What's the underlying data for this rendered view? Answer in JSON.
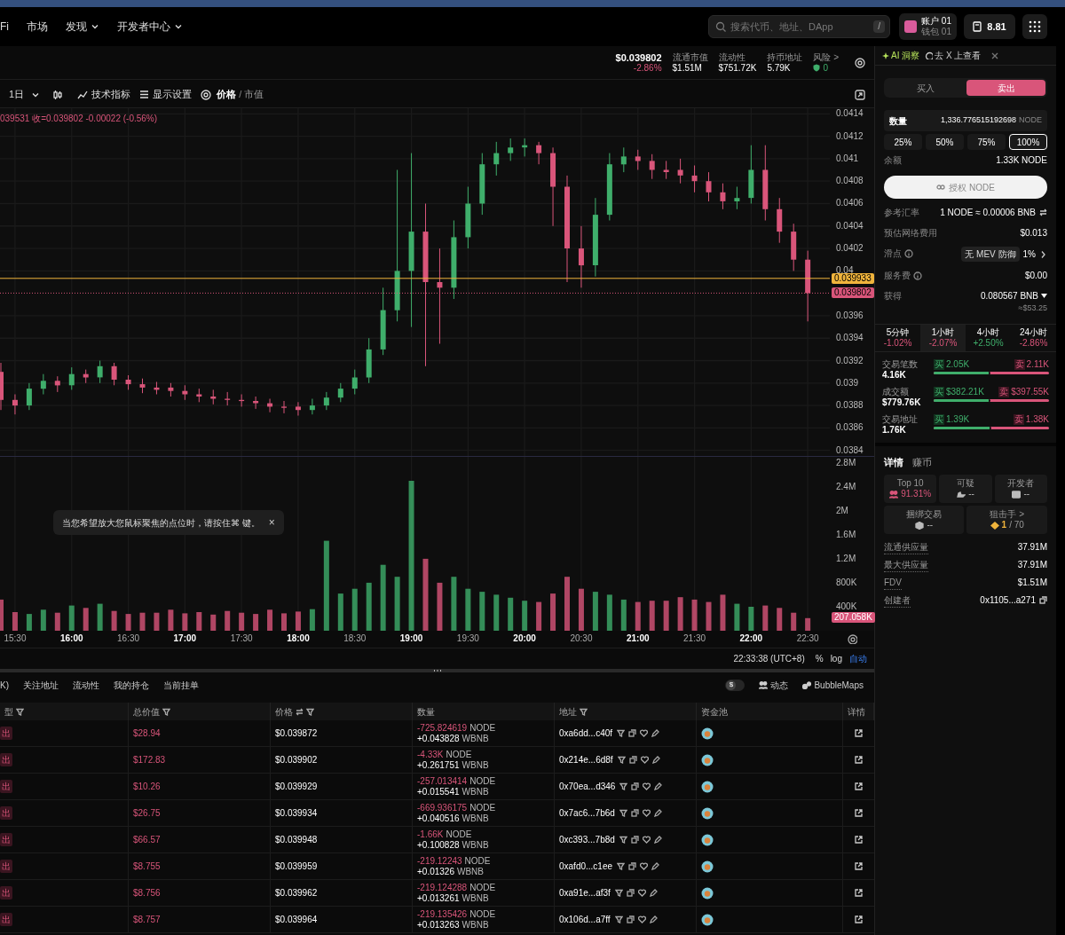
{
  "nav": {
    "items": [
      {
        "label": "Fi",
        "dropdown": false
      },
      {
        "label": "市场",
        "dropdown": false
      },
      {
        "label": "发现",
        "dropdown": true
      },
      {
        "label": "开发者中心",
        "dropdown": true
      }
    ],
    "search_placeholder": "搜索代币、地址、DApp",
    "search_shortcut": "/",
    "account": {
      "name": "账户 01",
      "wallet": "钱包 01"
    },
    "balance": "8.81"
  },
  "token_stats": {
    "price": "$0.039802",
    "change": "-2.86%",
    "stats": [
      {
        "label": "流通市值",
        "value": "$1.51M"
      },
      {
        "label": "流动性",
        "value": "$751.72K"
      },
      {
        "label": "持币地址",
        "value": "5.79K"
      }
    ],
    "risk": {
      "label": "风险 >",
      "value": "0"
    }
  },
  "chart_toolbar": {
    "interval": "1日",
    "indicators": "技术指标",
    "display": "显示设置",
    "modes": [
      {
        "label": "价格",
        "selected": true
      },
      {
        "label": "市值",
        "selected": false
      }
    ],
    "separator": "/"
  },
  "chart": {
    "price": {
      "legend": "039531 收=0.039802 -0.00022 (-0.56%)",
      "chart_data": {
        "type": "candlestick",
        "grid": true,
        "categories": [
          null,
          null,
          null,
          null,
          null,
          null,
          null,
          null,
          null,
          null,
          null,
          null,
          null,
          null,
          null,
          null,
          null,
          null,
          null,
          null,
          null,
          null,
          null,
          null,
          null,
          null,
          null,
          null,
          null,
          null,
          null,
          null,
          null,
          null,
          null,
          null,
          null,
          null,
          null,
          null,
          null,
          null,
          null,
          null,
          null,
          null,
          null,
          null,
          null,
          null,
          null,
          null,
          null,
          null,
          null,
          null,
          null,
          null
        ],
        "ohlc": [
          [
            0.0391,
            0.03918,
            0.03876,
            0.03885
          ],
          [
            0.03885,
            0.0389,
            0.03872,
            0.0388
          ],
          [
            0.0388,
            0.039,
            0.03876,
            0.03895
          ],
          [
            0.03895,
            0.03908,
            0.0389,
            0.03902
          ],
          [
            0.03902,
            0.03906,
            0.03892,
            0.03898
          ],
          [
            0.03898,
            0.03914,
            0.03894,
            0.03908
          ],
          [
            0.03908,
            0.03912,
            0.039,
            0.03905
          ],
          [
            0.03905,
            0.0392,
            0.039,
            0.03915
          ],
          [
            0.03915,
            0.03918,
            0.03898,
            0.03903
          ],
          [
            0.03903,
            0.03907,
            0.03894,
            0.03899
          ],
          [
            0.03899,
            0.03904,
            0.03891,
            0.03896
          ],
          [
            0.03896,
            0.03901,
            0.0389,
            0.03894
          ],
          [
            0.03896,
            0.039,
            0.03888,
            0.03893
          ],
          [
            0.03893,
            0.03898,
            0.03885,
            0.0389
          ],
          [
            0.0389,
            0.03895,
            0.03883,
            0.03888
          ],
          [
            0.03888,
            0.03894,
            0.03881,
            0.03886
          ],
          [
            0.03886,
            0.03892,
            0.0388,
            0.03885
          ],
          [
            0.03885,
            0.0389,
            0.03879,
            0.03884
          ],
          [
            0.03884,
            0.03888,
            0.03877,
            0.03882
          ],
          [
            0.03882,
            0.03886,
            0.03874,
            0.03879
          ],
          [
            0.03879,
            0.03884,
            0.03873,
            0.03878
          ],
          [
            0.03879,
            0.03883,
            0.03871,
            0.03876
          ],
          [
            0.03876,
            0.03886,
            0.03872,
            0.0388
          ],
          [
            0.0388,
            0.03892,
            0.03876,
            0.03887
          ],
          [
            0.03887,
            0.039,
            0.03883,
            0.03895
          ],
          [
            0.03895,
            0.03912,
            0.0389,
            0.03905
          ],
          [
            0.03905,
            0.0394,
            0.039,
            0.0393
          ],
          [
            0.0393,
            0.03985,
            0.03925,
            0.03965
          ],
          [
            0.03965,
            0.0409,
            0.03955,
            0.04
          ],
          [
            0.04,
            0.04105,
            0.0395,
            0.04035
          ],
          [
            0.04035,
            0.0406,
            0.03915,
            0.0399
          ],
          [
            0.0399,
            0.0402,
            0.03935,
            0.03985
          ],
          [
            0.03985,
            0.04045,
            0.03975,
            0.0403
          ],
          [
            0.0403,
            0.04075,
            0.0402,
            0.0406
          ],
          [
            0.0406,
            0.04105,
            0.0405,
            0.04095
          ],
          [
            0.04095,
            0.04115,
            0.04085,
            0.04105
          ],
          [
            0.04105,
            0.04118,
            0.04098,
            0.0411
          ],
          [
            0.0411,
            0.04118,
            0.04102,
            0.04112
          ],
          [
            0.04112,
            0.04115,
            0.04095,
            0.04105
          ],
          [
            0.04105,
            0.0411,
            0.0404,
            0.04075
          ],
          [
            0.04075,
            0.04085,
            0.0399,
            0.0402
          ],
          [
            0.0402,
            0.0404,
            0.03985,
            0.04005
          ],
          [
            0.04005,
            0.04065,
            0.03995,
            0.0405
          ],
          [
            0.0405,
            0.04105,
            0.04045,
            0.04095
          ],
          [
            0.04095,
            0.0411,
            0.04088,
            0.04102
          ],
          [
            0.04102,
            0.04108,
            0.0409,
            0.04098
          ],
          [
            0.04098,
            0.04104,
            0.04082,
            0.0409
          ],
          [
            0.0409,
            0.04098,
            0.04082,
            0.04088
          ],
          [
            0.0409,
            0.041,
            0.04078,
            0.04085
          ],
          [
            0.04085,
            0.04094,
            0.0407,
            0.0408
          ],
          [
            0.0408,
            0.04088,
            0.04062,
            0.0407
          ],
          [
            0.0407,
            0.04078,
            0.04055,
            0.04062
          ],
          [
            0.04062,
            0.04075,
            0.04055,
            0.04065
          ],
          [
            0.04065,
            0.04112,
            0.0406,
            0.0409
          ],
          [
            0.0409,
            0.04112,
            0.04045,
            0.04055
          ],
          [
            0.04055,
            0.04065,
            0.04025,
            0.04035
          ],
          [
            0.04035,
            0.04042,
            0.04,
            0.0401
          ],
          [
            0.0401,
            0.04018,
            0.03955,
            0.039802
          ]
        ],
        "ylim": [
          0.03835,
          0.04145
        ],
        "yticks": [
          0.0414,
          0.0412,
          0.041,
          0.0408,
          0.0406,
          0.0404,
          0.0402,
          0.04,
          0.0396,
          0.0394,
          0.0392,
          0.039,
          0.0388,
          0.0386,
          0.0384
        ],
        "ref_lines": [
          {
            "axis": "y",
            "value": 0.039933,
            "label": "0.039933",
            "color": "#f0b43c"
          },
          {
            "axis": "y",
            "value": 0.039802,
            "label": "0.039802",
            "color": "#d9557a"
          }
        ]
      }
    },
    "volume": {
      "chart_data": {
        "type": "bar",
        "grid": true,
        "categories": [
          null,
          "15:30",
          null,
          null,
          null,
          "16:00",
          null,
          null,
          null,
          "16:30",
          null,
          null,
          null,
          "17:00",
          null,
          null,
          null,
          "17:30",
          null,
          null,
          null,
          "18:00",
          null,
          null,
          null,
          "18:30",
          null,
          null,
          null,
          "19:00",
          null,
          null,
          null,
          "19:30",
          null,
          null,
          null,
          "20:00",
          null,
          null,
          null,
          "20:30",
          null,
          null,
          null,
          "21:00",
          null,
          null,
          null,
          "21:30",
          null,
          null,
          null,
          "22:00",
          null,
          null,
          null,
          "22:30"
        ],
        "values": [
          520000,
          310000,
          280000,
          350000,
          300000,
          420000,
          380000,
          450000,
          330000,
          280000,
          300000,
          300000,
          350000,
          290000,
          310000,
          270000,
          330000,
          300000,
          280000,
          350000,
          290000,
          320000,
          360000,
          1500000,
          620000,
          700000,
          800000,
          1100000,
          900000,
          2500000,
          1200000,
          800000,
          900000,
          700000,
          650000,
          600000,
          550000,
          500000,
          480000,
          620000,
          900000,
          700000,
          650000,
          600000,
          520000,
          480000,
          500000,
          500000,
          560000,
          520000,
          480000,
          600000,
          450000,
          400000,
          420000,
          380000,
          300000,
          210000
        ],
        "ylim": [
          0,
          2900000
        ],
        "yticks": [
          {
            "value": 2800000,
            "label": "2.8M"
          },
          {
            "value": 2400000,
            "label": "2.4M"
          },
          {
            "value": 2000000,
            "label": "2M"
          },
          {
            "value": 1600000,
            "label": "1.6M"
          },
          {
            "value": 1200000,
            "label": "1.2M"
          },
          {
            "value": 800000,
            "label": "800K"
          },
          {
            "value": 400000,
            "label": "400K"
          }
        ]
      },
      "tick_styles": [
        {
          "bold": false
        },
        {
          "bold": true
        },
        {
          "bold": false
        },
        {
          "bold": true
        },
        {
          "bold": false
        },
        {
          "bold": true
        },
        {
          "bold": false
        },
        {
          "bold": true
        },
        {
          "bold": false
        },
        {
          "bold": true
        },
        {
          "bold": false
        },
        {
          "bold": true
        },
        {
          "bold": false
        },
        {
          "bold": true
        },
        {
          "bold": false
        }
      ],
      "marker": "207.058K"
    },
    "tooltip": "当您希望放大您鼠标聚焦的点位时，请按住⌘ 键。",
    "tooltip_close": "×",
    "time": "22:33:38 (UTC+8)",
    "scale_options": [
      {
        "label": "%",
        "selected": false
      },
      {
        "label": "log",
        "selected": false
      },
      {
        "label": "自动",
        "selected": true
      }
    ]
  },
  "bottom_tabs": [
    {
      "label": "K)",
      "selected": false
    },
    {
      "label": "关注地址",
      "selected": false
    },
    {
      "label": "流动性",
      "selected": false
    },
    {
      "label": "我的持仓",
      "selected": false
    },
    {
      "label": "当前挂单",
      "selected": false
    }
  ],
  "usd_toggle": {
    "icon": "$",
    "on": false
  },
  "links": [
    "动态",
    "BubbleMaps"
  ],
  "table": {
    "columns": [
      {
        "label": "型",
        "filter": true,
        "sort": false
      },
      {
        "label": "总价值",
        "filter": true,
        "sort": false
      },
      {
        "label": "价格",
        "filter": true,
        "sort": true
      },
      {
        "label": "数量",
        "filter": false,
        "sort": false
      },
      {
        "label": "地址",
        "filter": true,
        "sort": false
      },
      {
        "label": "资金池",
        "filter": false,
        "sort": false
      },
      {
        "label": "详情",
        "filter": false,
        "sort": false
      }
    ],
    "rows": [
      {
        "type": "出",
        "total": "$28.94",
        "price": "$0.039872",
        "node": "-725.824619",
        "node_unit": "NODE",
        "wbnb": "+0.043828",
        "wbnb_unit": "WBNB",
        "address": "0xa6dd...c40f"
      },
      {
        "type": "出",
        "total": "$172.83",
        "price": "$0.039902",
        "node": "-4.33K",
        "node_unit": "NODE",
        "wbnb": "+0.261751",
        "wbnb_unit": "WBNB",
        "address": "0x214e...6d8f"
      },
      {
        "type": "出",
        "total": "$10.26",
        "price": "$0.039929",
        "node": "-257.013414",
        "node_unit": "NODE",
        "wbnb": "+0.015541",
        "wbnb_unit": "WBNB",
        "address": "0x70ea...d346"
      },
      {
        "type": "出",
        "total": "$26.75",
        "price": "$0.039934",
        "node": "-669.936175",
        "node_unit": "NODE",
        "wbnb": "+0.040516",
        "wbnb_unit": "WBNB",
        "address": "0x7ac6...7b6d"
      },
      {
        "type": "出",
        "total": "$66.57",
        "price": "$0.039948",
        "node": "-1.66K",
        "node_unit": "NODE",
        "wbnb": "+0.100828",
        "wbnb_unit": "WBNB",
        "address": "0xc393...7b8d"
      },
      {
        "type": "出",
        "total": "$8.755",
        "price": "$0.039959",
        "node": "-219.12243",
        "node_unit": "NODE",
        "wbnb": "+0.01326",
        "wbnb_unit": "WBNB",
        "address": "0xafd0...c1ee"
      },
      {
        "type": "出",
        "total": "$8.756",
        "price": "$0.039962",
        "node": "-219.124288",
        "node_unit": "NODE",
        "wbnb": "+0.013261",
        "wbnb_unit": "WBNB",
        "address": "0xa91e...af3f"
      },
      {
        "type": "出",
        "total": "$8.757",
        "price": "$0.039964",
        "node": "-219.135426",
        "node_unit": "NODE",
        "wbnb": "+0.013263",
        "wbnb_unit": "WBNB",
        "address": "0x106d...a7ff"
      }
    ]
  },
  "insight": {
    "ai": "AI 洞察",
    "x_link": "去 X 上查看"
  },
  "trade": {
    "sides": [
      {
        "label": "买入",
        "selected": false
      },
      {
        "label": "卖出",
        "selected": true
      }
    ],
    "amount_label": "数量",
    "amount": "1,336.776515192698",
    "amount_unit": "NODE",
    "percents": [
      {
        "label": "25%",
        "selected": false
      },
      {
        "label": "50%",
        "selected": false
      },
      {
        "label": "75%",
        "selected": false
      },
      {
        "label": "100%",
        "selected": true
      }
    ],
    "balance_label": "余额",
    "balance": "1.33K NODE",
    "approve": "授权 NODE",
    "rows": [
      {
        "kind": "rate",
        "label": "参考汇率",
        "value": "1 NODE ≈ 0.00006 BNB"
      },
      {
        "kind": "plain",
        "label": "预估网络费用",
        "value": "$0.013"
      },
      {
        "kind": "slippage",
        "label": "滑点",
        "badge": "无 MEV 防御",
        "value": "1%"
      },
      {
        "kind": "info",
        "label": "服务费",
        "value": "$0.00"
      },
      {
        "kind": "receive",
        "label": "获得",
        "value": "0.080567 BNB",
        "sub": "≈$53.25"
      }
    ]
  },
  "periods": [
    {
      "label": "5分钟",
      "change": "-1.02%",
      "rising": false,
      "selected": false
    },
    {
      "label": "1小时",
      "change": "-2.07%",
      "rising": false,
      "selected": true
    },
    {
      "label": "4小时",
      "change": "+2.50%",
      "rising": true,
      "selected": false
    },
    {
      "label": "24小时",
      "change": "-2.86%",
      "rising": false,
      "selected": false
    }
  ],
  "flows": [
    {
      "label": "交易笔数",
      "total": "4.16K",
      "buy_tag": "买",
      "buy": "2.05K",
      "sell_tag": "卖",
      "sell": "2.11K",
      "level": 0.49
    },
    {
      "label": "成交额",
      "total": "$779.76K",
      "buy_tag": "买",
      "buy": "$382.21K",
      "sell_tag": "卖",
      "sell": "$397.55K",
      "level": 0.49
    },
    {
      "label": "交易地址",
      "total": "1.76K",
      "buy_tag": "买",
      "buy": "1.39K",
      "sell_tag": "卖",
      "sell": "1.38K",
      "level": 0.5
    }
  ],
  "details": {
    "tabs": [
      {
        "label": "详情",
        "selected": true
      },
      {
        "label": "赚币",
        "selected": false
      }
    ],
    "cards": [
      {
        "kind": "top10",
        "label": "Top 10",
        "value": "91.31%"
      },
      {
        "kind": "suspicious",
        "label": "可疑",
        "value": "--"
      },
      {
        "kind": "dev",
        "label": "开发者",
        "value": "--"
      },
      {
        "kind": "bundle",
        "label": "捆绑交易",
        "value": "--"
      },
      {
        "kind": "sniper",
        "label": "狙击手 >",
        "value": "1",
        "total": "/ 70"
      }
    ],
    "rows": [
      {
        "label": "流通供应量",
        "value": "37.91M",
        "copy": false
      },
      {
        "label": "最大供应量",
        "value": "37.91M",
        "copy": false
      },
      {
        "label": "FDV",
        "value": "$1.51M",
        "copy": false
      },
      {
        "label": "创建者",
        "value": "0x1105...a271",
        "copy": true
      }
    ]
  }
}
